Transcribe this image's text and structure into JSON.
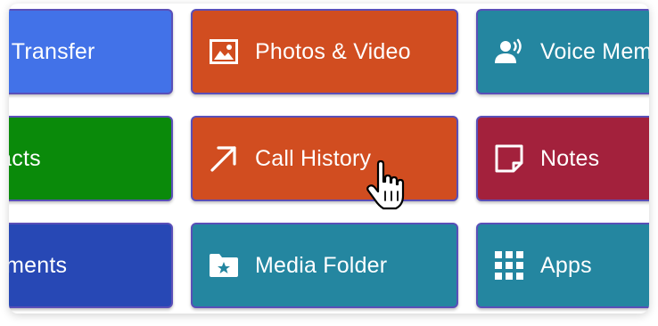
{
  "tiles": [
    {
      "label": "o Transfer",
      "color": "#4272e8"
    },
    {
      "label": "Photos & Video",
      "color": "#d14d20",
      "icon": "image-icon"
    },
    {
      "label": "Voice Memo",
      "color": "#2486a0",
      "icon": "voice-icon"
    },
    {
      "label": "tacts",
      "color": "#0a8a0a"
    },
    {
      "label": "Call History",
      "color": "#d14d20",
      "icon": "arrow-up-right-icon"
    },
    {
      "label": "Notes",
      "color": "#a3213c",
      "icon": "note-icon"
    },
    {
      "label": "uments",
      "color": "#2748b5"
    },
    {
      "label": "Media Folder",
      "color": "#2486a0",
      "icon": "folder-star-icon"
    },
    {
      "label": "Apps",
      "color": "#2486a0",
      "icon": "apps-grid-icon"
    }
  ],
  "cursor": {
    "icon": "hand-pointer-icon"
  }
}
